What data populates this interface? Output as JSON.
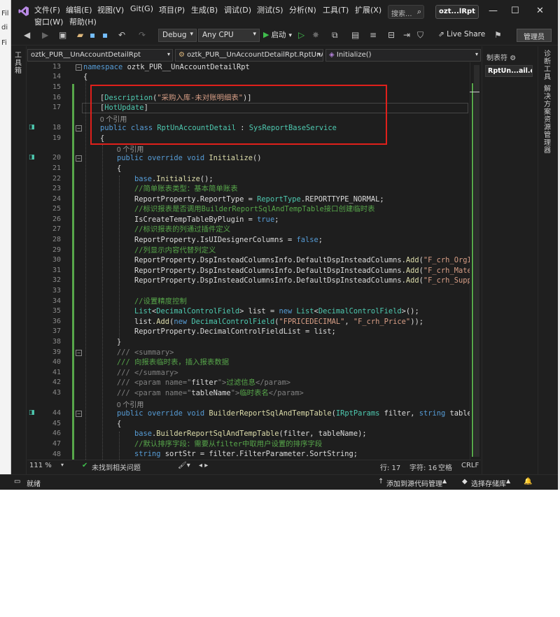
{
  "edge_fragments": [
    "Fil",
    "di",
    "Fi"
  ],
  "menu": {
    "row1": [
      "文件(F)",
      "编辑(E)",
      "视图(V)",
      "Git(G)",
      "项目(P)",
      "生成(B)",
      "调试(D)",
      "测试(S)",
      "分析(N)",
      "工具(T)",
      "扩展(X)"
    ],
    "row2": [
      "窗口(W)",
      "帮助(H)"
    ]
  },
  "search": {
    "placeholder": "搜索...",
    "icon": "search-icon"
  },
  "solution_name": "ozt...lRpt",
  "window_controls": [
    "—",
    "☐",
    "✕"
  ],
  "toolbar": {
    "config": "Debug",
    "platform": "Any CPU",
    "start_label": "启动",
    "live_share": "Live Share",
    "admin_label": "管理员"
  },
  "left_strip": {
    "toolbox_label": "工具箱"
  },
  "navbar": {
    "project": "oztk_PUR__UnAccountDetailRpt",
    "class": "oztk_PUR__UnAccountDetailRpt.RptUnAc",
    "member": "Initialize()"
  },
  "editor": {
    "annot_color": "#e0201b",
    "lines": [
      13,
      14,
      15,
      16,
      17,
      "",
      18,
      19,
      "",
      20,
      21,
      22,
      23,
      24,
      25,
      26,
      27,
      28,
      29,
      30,
      31,
      32,
      33,
      34,
      35,
      36,
      37,
      38,
      39,
      40,
      41,
      42,
      43,
      "",
      44,
      45,
      46,
      47,
      48
    ],
    "ref_text_zero": "0 个引用",
    "ref_text_zero_b": "0 个引用",
    "ref_text_zero_c": "0 个引用",
    "c13": {
      "kw": "namespace",
      "rest": " oztk_PUR__UnAccountDetailRpt"
    },
    "c14": "{",
    "c16": {
      "open": "[",
      "attr": "Description",
      "p1": "(",
      "str": "\"采购入库-未对账明细表\"",
      "close": ")]"
    },
    "c17": {
      "open": "[",
      "attr": "HotUpdate",
      "close": "]"
    },
    "c18": {
      "kw1": "public",
      "kw2": "class",
      "name": "RptUnAccountDetail",
      "colon": " : ",
      "base": "SysReportBaseService"
    },
    "c19": "{",
    "c20": {
      "kw1": "public",
      "kw2": "override",
      "kw3": "void",
      "name": "Initialize",
      "rest": "()"
    },
    "c21": "{",
    "c22": {
      "kw": "base",
      "dot": ".",
      "m": "Initialize",
      "rest": "();"
    },
    "c23": "//简单账表类型：基本简单账表",
    "c24": {
      "a": "ReportProperty.ReportType = ",
      "t": "ReportType",
      "b": ".REPORTTYPE_NORMAL;"
    },
    "c25": "//标识报表是否调用BuilderReportSqlAndTempTable接口创建临时表",
    "c26": {
      "a": "IsCreateTempTableByPlugin = ",
      "kw": "true",
      "b": ";"
    },
    "c27": "//标识报表的列通过插件定义",
    "c28": {
      "a": "ReportProperty.IsUIDesignerColumns = ",
      "kw": "false",
      "b": ";"
    },
    "c29": "//列显示内容代替列定义",
    "c30": {
      "a": "ReportProperty.DspInsteadColumnsInfo.DefaultDspInsteadColumns.",
      "m": "Add",
      "b": "(",
      "s": "\"F_crh_OrgId"
    },
    "c31": {
      "a": "ReportProperty.DspInsteadColumnsInfo.DefaultDspInsteadColumns.",
      "m": "Add",
      "b": "(",
      "s": "\"F_crh_Mater"
    },
    "c32": {
      "a": "ReportProperty.DspInsteadColumnsInfo.DefaultDspInsteadColumns.",
      "m": "Add",
      "b": "(",
      "s": "\"F_crh_Suppl"
    },
    "c34": "//设置精度控制",
    "c35": {
      "t1": "List",
      "lt": "<",
      "t2": "DecimalControlField",
      "gt": "> list = ",
      "kw": "new",
      "sp": " ",
      "t3": "List",
      "lt2": "<",
      "t4": "DecimalControlField",
      "end": ">();"
    },
    "c36": {
      "a": "list.",
      "m": "Add",
      "b": "(",
      "kw": "new",
      "sp": " ",
      "t": "DecimalControlField",
      "c": "(",
      "s1": "\"FPRICEDECIMAL\"",
      "d": ", ",
      "s2": "\"F_crh_Price\"",
      "e": "));"
    },
    "c37": "ReportProperty.DecimalControlFieldList = list;",
    "c38": "}",
    "c39": {
      "x": "/// ",
      "t": "<summary>"
    },
    "c40": "/// 向报表临时表，插入报表数据",
    "c41": {
      "x": "/// ",
      "t": "</summary>"
    },
    "c42": {
      "x": "/// ",
      "t1": "<param ",
      "n": "name",
      "q": "=\"",
      "v": "filter",
      "q2": "\">",
      "txt": "过滤信息",
      "t2": "</param>"
    },
    "c43": {
      "x": "/// ",
      "t1": "<param ",
      "n": "name",
      "q": "=\"",
      "v": "tableName",
      "q2": "\">",
      "txt": "临时表名",
      "t2": "</param>"
    },
    "c44": {
      "kw1": "public",
      "kw2": "override",
      "kw3": "void",
      "m": "BuilderReportSqlAndTempTable",
      "p": "(",
      "t": "IRptParams",
      "a": " filter, ",
      "kw4": "string",
      "b": " tableN"
    },
    "c45": "{",
    "c46": {
      "kw": "base",
      "dot": ".",
      "m": "BuilderReportSqlAndTempTable",
      "rest": "(filter, tableName);"
    },
    "c47": "//默认排序字段：需要从filter中取用户设置的排序字段",
    "c48": {
      "kw": "string",
      "a": " sortStr = filter.FilterParameter.SortString;"
    }
  },
  "editor_status": {
    "zoom": "111 %",
    "issues": "未找到相关问题",
    "row": "行: 17",
    "col": "字符: 16",
    "ws": "空格",
    "eol": "CRLF"
  },
  "right_panel": {
    "title": "制表符",
    "item": "RptUn...ail.cs"
  },
  "right_strip": {
    "tab1": "诊断工具",
    "tab2": "解决方案资源管理器"
  },
  "statusbar": {
    "ready": "就绪",
    "add_source": "添加到源代码管理",
    "select_repo": "选择存储库"
  }
}
